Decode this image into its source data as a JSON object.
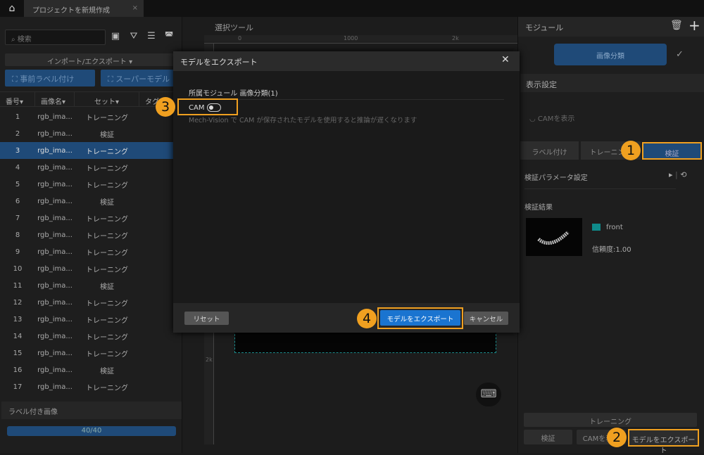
{
  "topbar": {
    "tab_title": "プロジェクトを新規作成",
    "close": "×"
  },
  "left": {
    "search_placeholder": "検索",
    "import_export": "インポート/エクスポート ▾",
    "pre_label": "事前ラベル付け",
    "super_model": "スーパーモデル",
    "columns": [
      "番号▾",
      "画像名▾",
      "セット▾",
      "タグ▾"
    ],
    "rows": [
      {
        "no": "1",
        "name": "rgb_ima...",
        "set": "トレーニング"
      },
      {
        "no": "2",
        "name": "rgb_ima...",
        "set": "検証"
      },
      {
        "no": "3",
        "name": "rgb_ima...",
        "set": "トレーニング",
        "selected": true
      },
      {
        "no": "4",
        "name": "rgb_ima...",
        "set": "トレーニング"
      },
      {
        "no": "5",
        "name": "rgb_ima...",
        "set": "トレーニング"
      },
      {
        "no": "6",
        "name": "rgb_ima...",
        "set": "検証"
      },
      {
        "no": "7",
        "name": "rgb_ima...",
        "set": "トレーニング"
      },
      {
        "no": "8",
        "name": "rgb_ima...",
        "set": "トレーニング"
      },
      {
        "no": "9",
        "name": "rgb_ima...",
        "set": "トレーニング"
      },
      {
        "no": "10",
        "name": "rgb_ima...",
        "set": "トレーニング"
      },
      {
        "no": "11",
        "name": "rgb_ima...",
        "set": "検証"
      },
      {
        "no": "12",
        "name": "rgb_ima...",
        "set": "トレーニング"
      },
      {
        "no": "13",
        "name": "rgb_ima...",
        "set": "トレーニング"
      },
      {
        "no": "14",
        "name": "rgb_ima...",
        "set": "トレーニング"
      },
      {
        "no": "15",
        "name": "rgb_ima...",
        "set": "トレーニング"
      },
      {
        "no": "16",
        "name": "rgb_ima...",
        "set": "検証"
      },
      {
        "no": "17",
        "name": "rgb_ima...",
        "set": "トレーニング"
      }
    ],
    "labeled_title": "ラベル付き画像",
    "progress_text": "40/40",
    "progress": 1.0
  },
  "canvas": {
    "title": "選択ツール",
    "ruler": [
      "0",
      "1000",
      "2k"
    ],
    "vruler": "2k"
  },
  "right": {
    "module_title": "モジュール",
    "module_node": "画像分類",
    "display_settings": "表示設定",
    "show_cam": "CAMを表示",
    "tabs": [
      "ラベル付け",
      "トレーニング",
      "検証"
    ],
    "val_params": "検証パラメータ設定",
    "val_results": "検証結果",
    "class_name": "front",
    "class_color": "#0f8a8a",
    "confidence": "信頼度:1.00",
    "train_btn": "トレーニング",
    "val_btn": "検証",
    "cam_btn": "CAMを表示",
    "export_btn": "モデルをエクスポート"
  },
  "dialog": {
    "title": "モデルをエクスポート",
    "module_label": "所属モジュール 画像分類(1)",
    "cam_label": "CAM",
    "cam_on": false,
    "cam_note": "Mech-Vision で CAM が保存されたモデルを使用すると推論が遅くなります",
    "reset": "リセット",
    "export": "モデルをエクスポート",
    "cancel": "キャンセル"
  },
  "badges": [
    "1",
    "2",
    "3",
    "4"
  ],
  "accent": "#f0a020"
}
